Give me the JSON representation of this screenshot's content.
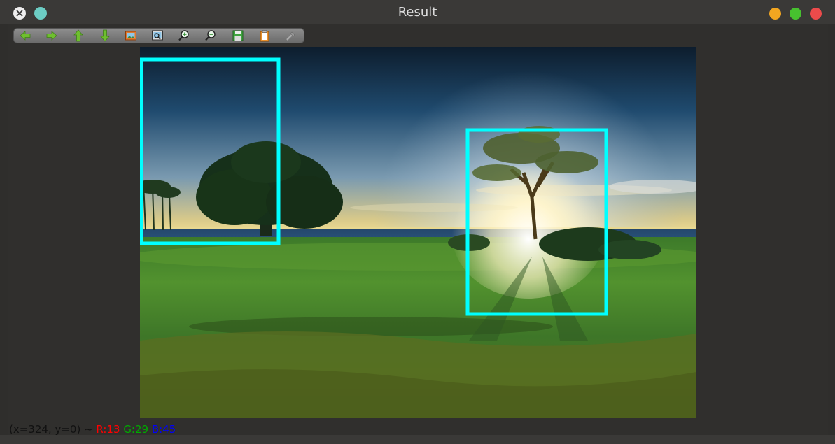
{
  "window": {
    "title": "Result"
  },
  "toolbar": {
    "tools": [
      "arrow-left-icon",
      "arrow-right-icon",
      "arrow-up-icon",
      "arrow-down-icon",
      "image-icon",
      "zoom-fit-icon",
      "zoom-in-icon",
      "zoom-out-icon",
      "save-icon",
      "clipboard-icon",
      "properties-icon"
    ]
  },
  "status": {
    "coords": "(x=324, y=0) ~ ",
    "r": "R:13",
    "g": "G:29",
    "b": "B:45"
  },
  "colors": {
    "box_color": "#00ffff",
    "r_color": "#ff0000",
    "g_color": "#00aa00",
    "b_color": "#0000ff"
  }
}
